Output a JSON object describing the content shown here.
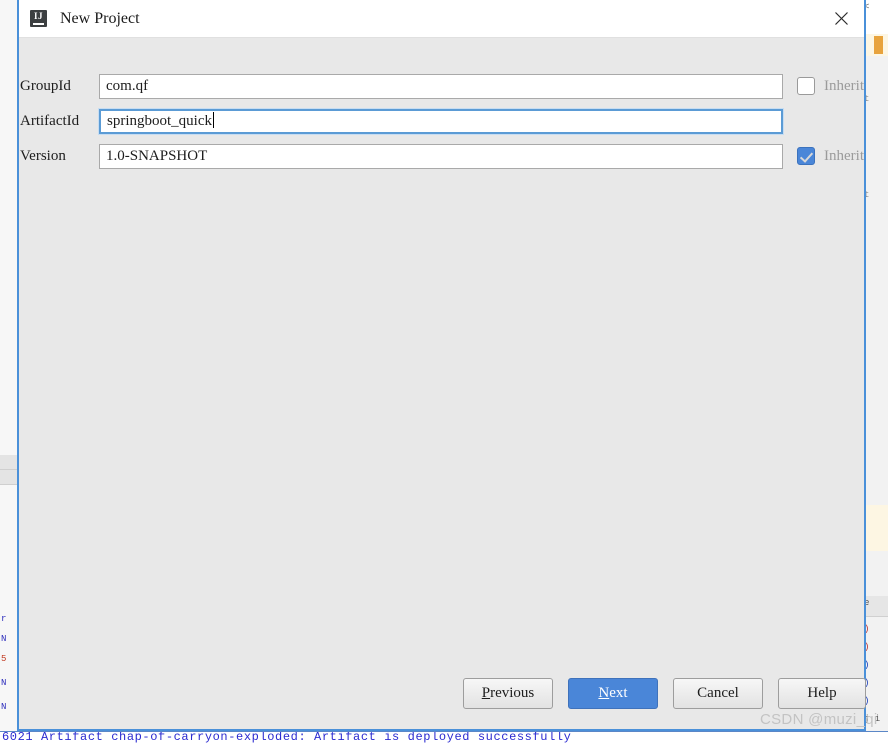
{
  "dialog": {
    "title": "New Project",
    "icon": "intellij-idea-icon",
    "close_icon": "close-icon",
    "accent_color": "#4a86d8",
    "border_color": "#4a90d9",
    "body_color": "#e8e8e8"
  },
  "form": {
    "rows": [
      {
        "label": "GroupId",
        "value": "com.qf",
        "focused": false,
        "inherit_label": "Inherit",
        "inherit_checked": false
      },
      {
        "label": "ArtifactId",
        "value": "springboot_quick",
        "focused": true,
        "inherit_label": "",
        "inherit_checked": false
      },
      {
        "label": "Version",
        "value": "1.0-SNAPSHOT",
        "focused": false,
        "inherit_label": "Inherit",
        "inherit_checked": true
      }
    ]
  },
  "footer": {
    "buttons": [
      {
        "label": "Previous",
        "mnemonic": "P",
        "rest": "revious",
        "primary": false
      },
      {
        "label": "Next",
        "mnemonic": "N",
        "rest": "ext",
        "primary": true
      },
      {
        "label": "Cancel",
        "mnemonic": "",
        "rest": "Cancel",
        "primary": false
      },
      {
        "label": "Help",
        "mnemonic": "",
        "rest": "Help",
        "primary": false
      }
    ]
  },
  "watermark": "CSDN @muzi_qi",
  "background": {
    "console_text": "6021  Artifact chap-of-carryon-exploded: Artifact is deployed successfully"
  }
}
